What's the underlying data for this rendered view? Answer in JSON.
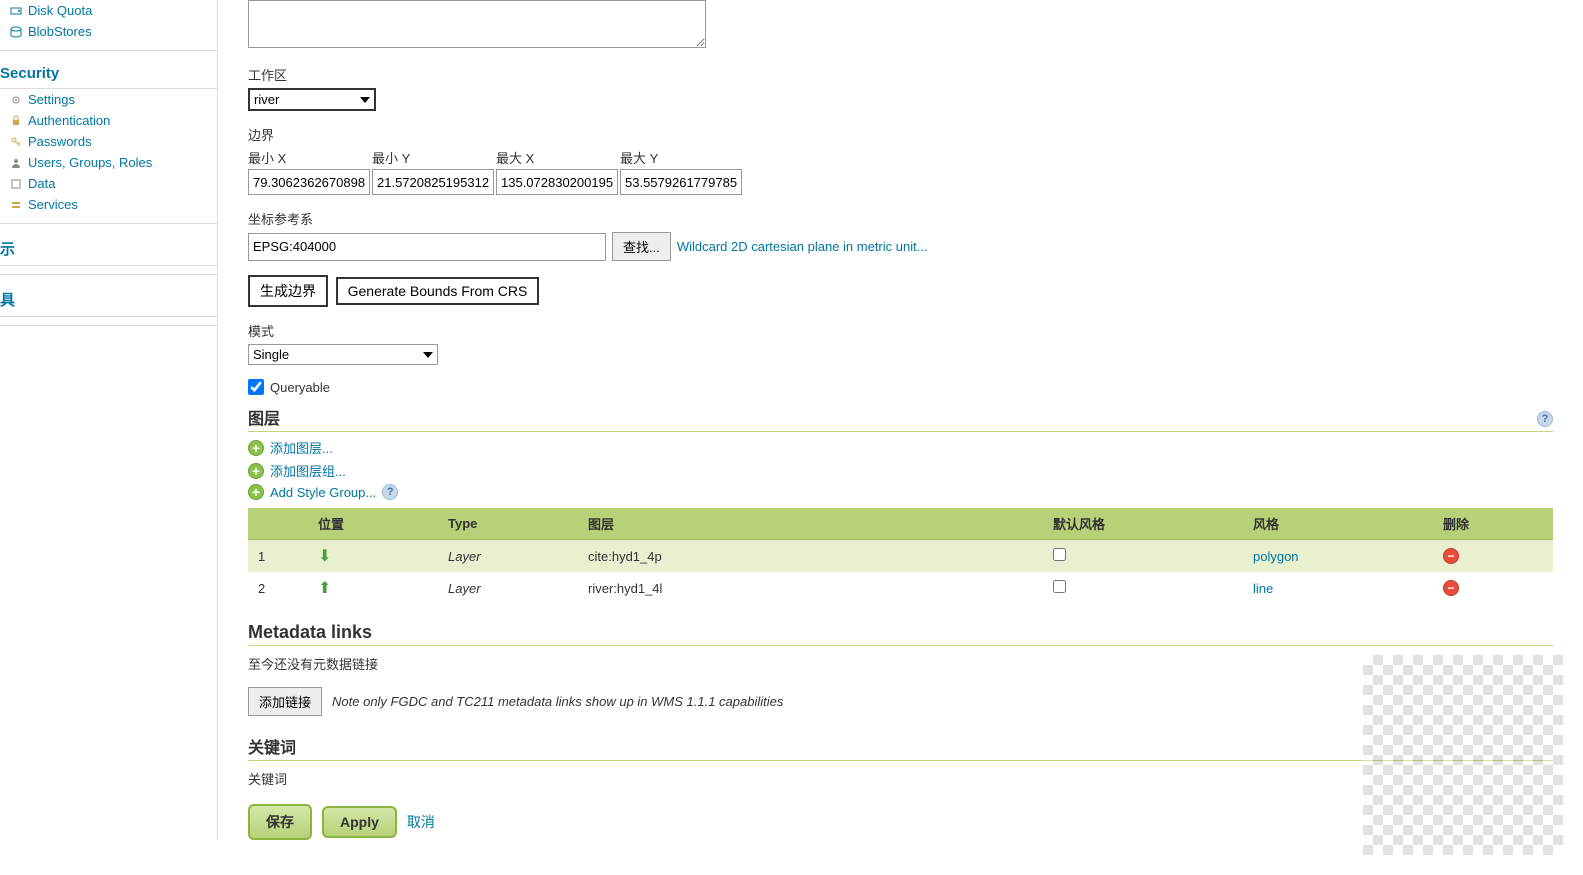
{
  "sidebar": {
    "tile_items": [
      {
        "label": "Disk Quota"
      },
      {
        "label": "BlobStores"
      }
    ],
    "security_header": "Security",
    "security_items": [
      {
        "label": "Settings"
      },
      {
        "label": "Authentication"
      },
      {
        "label": "Passwords"
      },
      {
        "label": "Users, Groups, Roles"
      },
      {
        "label": "Data"
      },
      {
        "label": "Services"
      }
    ],
    "demo_header": "示",
    "tools_header": "具"
  },
  "form": {
    "workspace_label": "工作区",
    "workspace_value": "river",
    "bounds_label": "边界",
    "min_x_label": "最小 X",
    "min_y_label": "最小 Y",
    "max_x_label": "最大 X",
    "max_y_label": "最大 Y",
    "min_x_value": "79.3062362670898",
    "min_y_value": "21.5720825195312",
    "max_x_value": "135.072830200195",
    "max_y_value": "53.5579261779785",
    "crs_label": "坐标参考系",
    "crs_value": "EPSG:404000",
    "find_button": "查找...",
    "crs_link": "Wildcard 2D cartesian plane in metric unit...",
    "gen_bounds_button": "生成边界",
    "gen_bounds_crs_button": "Generate Bounds From CRS",
    "mode_label": "模式",
    "mode_value": "Single",
    "queryable_label": "Queryable"
  },
  "layers": {
    "title": "图层",
    "add_layer": "添加图层...",
    "add_layer_group": "添加图层组...",
    "add_style_group": "Add Style Group...",
    "headers": {
      "position": "位置",
      "type": "Type",
      "layer": "图层",
      "default_style": "默认风格",
      "style": "风格",
      "delete": "删除"
    },
    "rows": [
      {
        "pos": "1",
        "type": "Layer",
        "layer": "cite:hyd1_4p",
        "style": "polygon"
      },
      {
        "pos": "2",
        "type": "Layer",
        "layer": "river:hyd1_4l",
        "style": "line"
      }
    ]
  },
  "metadata": {
    "title": "Metadata links",
    "empty_text": "至今还没有元数据链接",
    "add_link_button": "添加链接",
    "note": "Note only FGDC and TC211 metadata links show up in WMS 1.1.1 capabilities"
  },
  "keywords": {
    "title": "关键词",
    "label": "关键词"
  },
  "actions": {
    "save": "保存",
    "apply": "Apply",
    "cancel": "取消"
  }
}
